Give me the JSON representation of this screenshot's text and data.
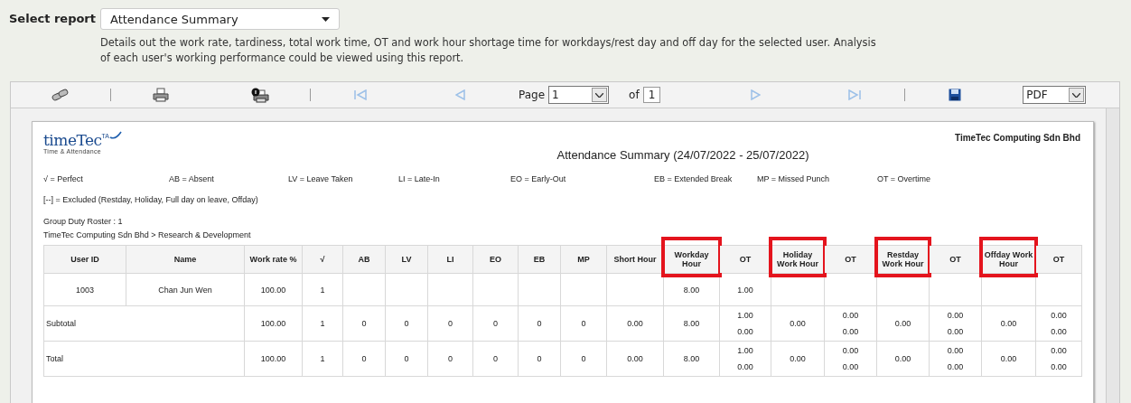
{
  "report_selector": {
    "label": "Select report",
    "value": "Attendance Summary",
    "description": "Details out the work rate, tardiness, total work time, OT and work hour shortage time for workdays/rest day and off day for the selected user. Analysis of each user's working performance could be viewed using this report."
  },
  "toolbar": {
    "nav_buttons": [
      {
        "kind": "first",
        "disabled": true
      },
      {
        "kind": "prev",
        "disabled": true
      },
      {
        "kind": "next",
        "disabled": true
      },
      {
        "kind": "last",
        "disabled": true
      }
    ],
    "page_label": "Page",
    "page_value": "1",
    "of_label": "of",
    "page_total": "1",
    "format": "PDF"
  },
  "report": {
    "logo": {
      "name": "timeTec",
      "badge": "TA",
      "tagline": "Time & Attendance"
    },
    "company": "TimeTec Computing Sdn Bhd",
    "title": "Attendance Summary (24/07/2022 - 25/07/2022)",
    "legend": [
      "√ = Perfect",
      "AB = Absent",
      "LV = Leave Taken",
      "LI = Late-In",
      "EO = Early-Out",
      "EB = Extended Break",
      "MP = Missed Punch",
      "OT = Overtime"
    ],
    "excluded_note": "[--] = Excluded (Restday, Holiday, Full day on leave, Offday)",
    "group": "Group Duty Roster : 1",
    "department": "TimeTec Computing Sdn Bhd > Research & Development",
    "table": {
      "columns": [
        {
          "label": "User ID",
          "highlighted": false
        },
        {
          "label": "Name",
          "highlighted": false
        },
        {
          "label": "Work rate %",
          "highlighted": false
        },
        {
          "label": "√",
          "highlighted": false
        },
        {
          "label": "AB",
          "highlighted": false
        },
        {
          "label": "LV",
          "highlighted": false
        },
        {
          "label": "LI",
          "highlighted": false
        },
        {
          "label": "EO",
          "highlighted": false
        },
        {
          "label": "EB",
          "highlighted": false
        },
        {
          "label": "MP",
          "highlighted": false
        },
        {
          "label": "Short Hour",
          "highlighted": false
        },
        {
          "label": "Workday Hour",
          "highlighted": true
        },
        {
          "label": "OT",
          "highlighted": false
        },
        {
          "label": "Holiday Work Hour",
          "highlighted": true
        },
        {
          "label": "OT",
          "highlighted": false
        },
        {
          "label": "Restday Work Hour",
          "highlighted": true
        },
        {
          "label": "OT",
          "highlighted": false
        },
        {
          "label": "Offday Work Hour",
          "highlighted": true
        },
        {
          "label": "OT",
          "highlighted": false
        }
      ],
      "rows": [
        {
          "kind": "user",
          "cells": [
            [
              "1003"
            ],
            [
              "Chan Jun Wen"
            ],
            [
              "100.00"
            ],
            [
              "1"
            ],
            [],
            [],
            [],
            [],
            [],
            [],
            [],
            [
              "8.00"
            ],
            [
              "1.00"
            ],
            [],
            [],
            [],
            [],
            [],
            []
          ]
        },
        {
          "kind": "summary",
          "cells": [
            {
              "text": "Subtotal",
              "colspan": 2
            },
            [
              "100.00"
            ],
            [
              "1"
            ],
            [
              "0"
            ],
            [
              "0"
            ],
            [
              "0"
            ],
            [
              "0"
            ],
            [
              "0"
            ],
            [
              "0"
            ],
            [
              "0.00"
            ],
            [
              "8.00"
            ],
            [
              "1.00",
              "0.00"
            ],
            [
              "0.00"
            ],
            [
              "0.00",
              "0.00"
            ],
            [
              "0.00"
            ],
            [
              "0.00",
              "0.00"
            ],
            [
              "0.00"
            ],
            [
              "0.00",
              "0.00"
            ]
          ]
        },
        {
          "kind": "summary",
          "cells": [
            {
              "text": "Total",
              "colspan": 2
            },
            [
              "100.00"
            ],
            [
              "1"
            ],
            [
              "0"
            ],
            [
              "0"
            ],
            [
              "0"
            ],
            [
              "0"
            ],
            [
              "0"
            ],
            [
              "0"
            ],
            [
              "0.00"
            ],
            [
              "8.00"
            ],
            [
              "1.00",
              "0.00"
            ],
            [
              "0.00"
            ],
            [
              "0.00",
              "0.00"
            ],
            [
              "0.00"
            ],
            [
              "0.00",
              "0.00"
            ],
            [
              "0.00"
            ],
            [
              "0.00",
              "0.00"
            ]
          ]
        }
      ]
    }
  }
}
